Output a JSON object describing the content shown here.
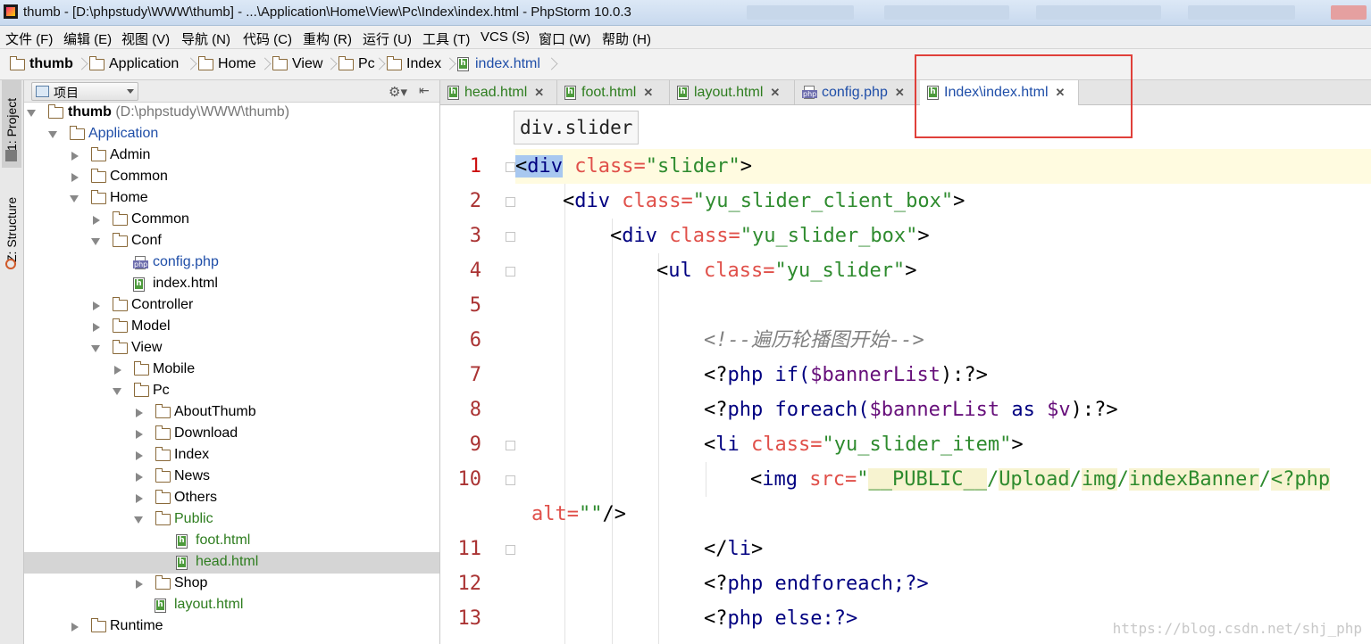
{
  "window": {
    "title": "thumb - [D:\\phpstudy\\WWW\\thumb] - ...\\Application\\Home\\View\\Pc\\Index\\index.html - PhpStorm 10.0.3"
  },
  "menu": [
    "文件 (F)",
    "编辑 (E)",
    "视图 (V)",
    "导航 (N)",
    "代码 (C)",
    "重构 (R)",
    "运行 (U)",
    "工具 (T)",
    "VCS (S)",
    "窗口 (W)",
    "帮助 (H)"
  ],
  "breadcrumb": [
    "thumb",
    "Application",
    "Home",
    "View",
    "Pc",
    "Index",
    "index.html"
  ],
  "toolstrip": {
    "project": "1: Project",
    "structure": "Z: Structure"
  },
  "project_panel": {
    "dropdown": "项目",
    "root_label": "thumb",
    "root_path": "(D:\\phpstudy\\WWW\\thumb)",
    "tree": [
      {
        "label": "Application",
        "color": "#1f4ea8"
      },
      {
        "label": "Admin"
      },
      {
        "label": "Common"
      },
      {
        "label": "Home"
      },
      {
        "label": "Common"
      },
      {
        "label": "Conf"
      },
      {
        "label": "config.php",
        "color": "#1f4ea8"
      },
      {
        "label": "index.html"
      },
      {
        "label": "Controller"
      },
      {
        "label": "Model"
      },
      {
        "label": "View"
      },
      {
        "label": "Mobile"
      },
      {
        "label": "Pc"
      },
      {
        "label": "AboutThumb"
      },
      {
        "label": "Download"
      },
      {
        "label": "Index"
      },
      {
        "label": "News"
      },
      {
        "label": "Others"
      },
      {
        "label": "Public",
        "color": "#2e7d1f"
      },
      {
        "label": "foot.html",
        "color": "#2e7d1f"
      },
      {
        "label": "head.html",
        "color": "#2e7d1f"
      },
      {
        "label": "Shop"
      },
      {
        "label": "layout.html",
        "color": "#2e7d1f"
      },
      {
        "label": "Runtime"
      }
    ]
  },
  "editor": {
    "tabs": [
      "head.html",
      "foot.html",
      "layout.html",
      "config.php",
      "Index\\index.html"
    ],
    "active_tab": "Index\\index.html",
    "tooltip": "div.slider",
    "line_numbers": [
      "1",
      "2",
      "3",
      "4",
      "5",
      "6",
      "7",
      "8",
      "9",
      "10",
      "",
      "11",
      "12",
      "13"
    ],
    "code": {
      "l1": [
        "<",
        "div",
        " ",
        "class=",
        "\"slider\"",
        ">"
      ],
      "l2": [
        "<",
        "div",
        " ",
        "class=",
        "\"yu_slider_client_box\"",
        ">"
      ],
      "l3": [
        "<",
        "div",
        " ",
        "class=",
        "\"yu_slider_box\"",
        ">"
      ],
      "l4": [
        "<",
        "ul",
        " ",
        "class=",
        "\"yu_slider\"",
        ">"
      ],
      "l6": "<!--遍历轮播图开始-->",
      "l7": [
        "<?",
        "php ",
        "if(",
        "$bannerList",
        "):?>"
      ],
      "l8": [
        "<?",
        "php ",
        "foreach(",
        "$bannerList",
        " as ",
        "$v",
        "):?>"
      ],
      "l9": [
        "<",
        "li",
        " ",
        "class=",
        "\"yu_slider_item\"",
        ">"
      ],
      "l10": [
        "<",
        "img",
        " ",
        "src=",
        "\"",
        "__PUBLIC__",
        "/",
        "Upload",
        "/",
        "img",
        "/",
        "indexBanner",
        "/",
        "<?php"
      ],
      "l10b": [
        "alt=",
        "\"\"",
        "/>"
      ],
      "l11": [
        "</",
        "li",
        ">"
      ],
      "l12": [
        "<?",
        "php ",
        "endforeach;?>"
      ],
      "l13": [
        "<?",
        "php ",
        "else:?>"
      ]
    },
    "colors": {
      "tag": "#000080",
      "attr": "#e0504a",
      "string": "#2e8b2e",
      "comment": "#808080",
      "variable": "#660e7a"
    }
  },
  "watermark": "https://blog.csdn.net/shj_php"
}
